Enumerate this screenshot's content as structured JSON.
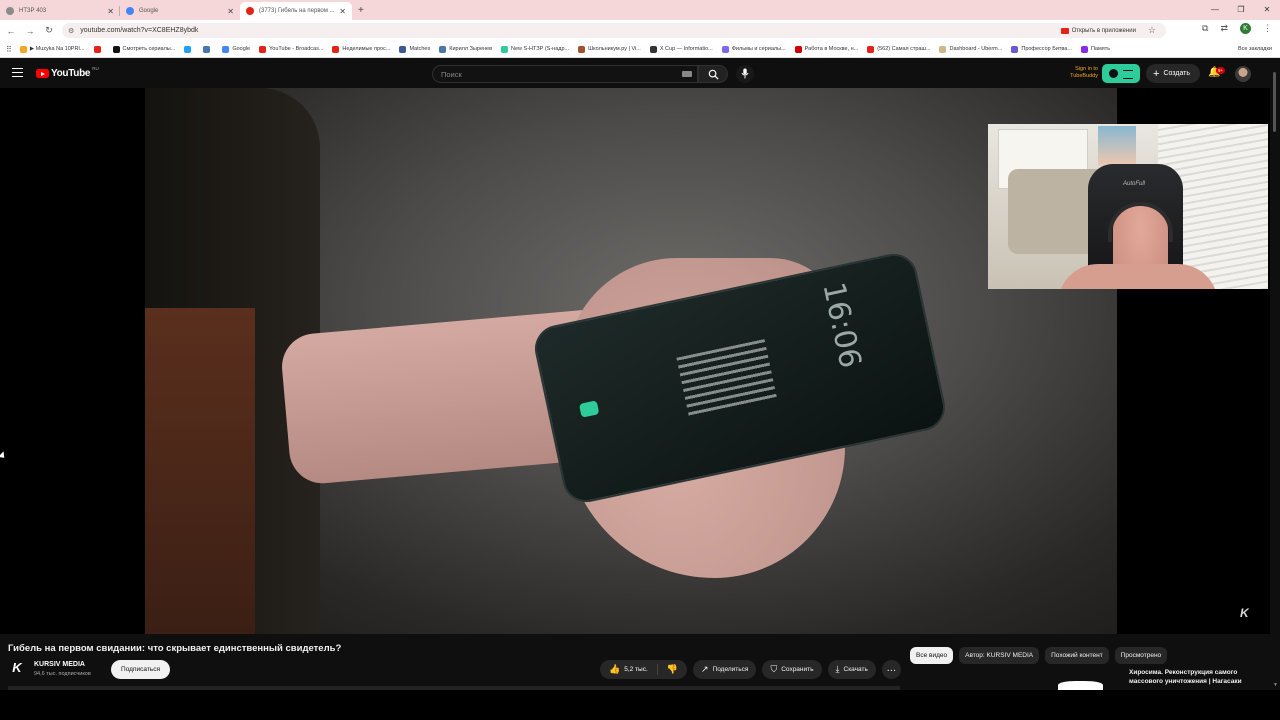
{
  "browser": {
    "tabs": [
      {
        "title": "НТЗР 403",
        "fav_color": "#8a8a8a",
        "active": false
      },
      {
        "title": "Google",
        "fav_color": "#4285f4",
        "active": false
      },
      {
        "title": "(3773) Гибель на первом ...",
        "fav_color": "#e62117",
        "active": true
      }
    ],
    "url": "youtube.com/watch?v=XC8EHZ8ybdk",
    "open_in_app": "Открыть в приложении",
    "profile_letter": "K",
    "bookmarks": [
      {
        "label": "▶ Muzyka Na 10PRI...",
        "color": "#f5a623"
      },
      {
        "label": "",
        "color": "#e62117"
      },
      {
        "label": "Смотреть сериалы...",
        "color": "#111111"
      },
      {
        "label": "",
        "color": "#1da1f2"
      },
      {
        "label": "",
        "color": "#4a76a8"
      },
      {
        "label": "Google",
        "color": "#4285f4"
      },
      {
        "label": "YouTube - Broadcas...",
        "color": "#e62117"
      },
      {
        "label": "Неделимые прос...",
        "color": "#e62117"
      },
      {
        "label": "Matches",
        "color": "#3b5998"
      },
      {
        "label": "Кирилл Зыренев",
        "color": "#4a76a8"
      },
      {
        "label": "New S-НТЗР (S-надр...",
        "color": "#2ecc9a"
      },
      {
        "label": "Школьникум.ру | Vi...",
        "color": "#a0522d"
      },
      {
        "label": "X Cup — Informatio...",
        "color": "#333333"
      },
      {
        "label": "Фильмы и сериалы...",
        "color": "#7b68ee"
      },
      {
        "label": "Работа в Москве, н...",
        "color": "#cc0000"
      },
      {
        "label": "(562) Самая страш...",
        "color": "#e62117"
      },
      {
        "label": "Dashboard - Uberm...",
        "color": "#d2b48c"
      },
      {
        "label": "Профессор Битва...",
        "color": "#6a5acd"
      },
      {
        "label": "Память",
        "color": "#8a2be2"
      }
    ],
    "all_bookmarks": "Все закладки"
  },
  "youtube": {
    "logo": "YouTube",
    "region": "RU",
    "search_placeholder": "Поиск",
    "signin_line1": "Sign in to",
    "signin_line2": "TubeBuddy",
    "create_label": "Создать",
    "notif_badge": "9+"
  },
  "video": {
    "title": "Гибель на первом свидании: что скрывает единственный свидетель?",
    "watermark": "K",
    "phone_time": "16:06",
    "webcam_chair_text": "AutoFull"
  },
  "channel": {
    "logo_letter": "K",
    "name": "KURSIV MEDIA",
    "subscribers": "94,6 тыс. подписчиков",
    "subscribe_label": "Подписаться"
  },
  "actions": {
    "likes": "5,2 тыс.",
    "share": "Поделиться",
    "save": "Сохранить",
    "download": "Скачать",
    "more": "…"
  },
  "chips": [
    "Все видео",
    "Автор: KURSIV MEDIA",
    "Похожий контент",
    "Просмотрено"
  ],
  "recommendation": {
    "title": "Хиросима. Реконструкция самого массового уничтожения | Нагасаки"
  }
}
